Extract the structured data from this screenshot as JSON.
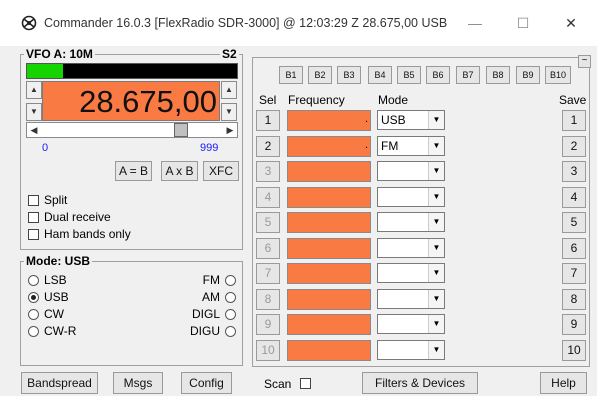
{
  "window": {
    "title": "Commander 16.0.3 [FlexRadio SDR-3000] @ 12:03:29 Z  28.675,00 USB",
    "minimize": "—",
    "maximize": "☐",
    "close": "✕"
  },
  "vfo": {
    "label": "VFO A: 10M",
    "side": "S2",
    "meter_level": 0.17,
    "frequency": "28.675,00",
    "range_min": "0",
    "range_max": "999",
    "slider_position": 0.79,
    "buttons": [
      "A = B",
      "A x B",
      "XFC"
    ],
    "options": [
      "Split",
      "Dual receive",
      "Ham bands only"
    ]
  },
  "mode": {
    "label": "Mode: USB",
    "left": [
      "LSB",
      "USB",
      "CW",
      "CW-R"
    ],
    "right": [
      "FM",
      "AM",
      "DIGL",
      "DIGU"
    ],
    "selected": "USB"
  },
  "banks": [
    "B1",
    "B2",
    "B3",
    "B4",
    "B5",
    "B6",
    "B7",
    "B8",
    "B9",
    "B10"
  ],
  "collapse_glyph": "~",
  "memory": {
    "headers": {
      "sel": "Sel",
      "frequency": "Frequency",
      "mode": "Mode",
      "save": "Save"
    },
    "rows": [
      {
        "n": "1",
        "mode": "USB",
        "dot": ".",
        "enabled": true
      },
      {
        "n": "2",
        "mode": "FM",
        "dot": ".",
        "enabled": true
      },
      {
        "n": "3",
        "mode": "",
        "dot": "",
        "enabled": false
      },
      {
        "n": "4",
        "mode": "",
        "dot": "",
        "enabled": false
      },
      {
        "n": "5",
        "mode": "",
        "dot": "",
        "enabled": false
      },
      {
        "n": "6",
        "mode": "",
        "dot": "",
        "enabled": false
      },
      {
        "n": "7",
        "mode": "",
        "dot": "",
        "enabled": false
      },
      {
        "n": "8",
        "mode": "",
        "dot": "",
        "enabled": false
      },
      {
        "n": "9",
        "mode": "",
        "dot": "",
        "enabled": false
      },
      {
        "n": "10",
        "mode": "",
        "dot": "",
        "enabled": false
      }
    ]
  },
  "bottom": {
    "bandspread": "Bandspread",
    "msgs": "Msgs",
    "config": "Config",
    "scan": "Scan",
    "filters": "Filters & Devices",
    "help": "Help"
  }
}
